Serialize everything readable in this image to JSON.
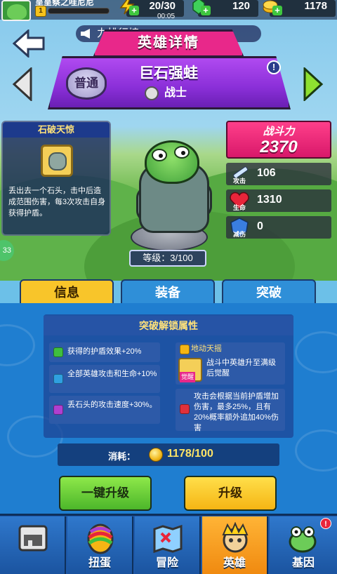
{
  "player": {
    "name": "呈呈察之哇尼尼",
    "level": "1"
  },
  "resources": {
    "energy": {
      "value": "20/30",
      "timer": "00:05"
    },
    "gems": {
      "value": "120"
    },
    "gold": {
      "value": "1178"
    }
  },
  "marquee": {
    "text": "力排行榜"
  },
  "header": {
    "title": "英雄详情",
    "rarity": "普通",
    "hero_name": "巨石强蛙",
    "hero_class": "战士",
    "info": "!"
  },
  "skill": {
    "name": "石破天惊",
    "description": "丢出去一个石头，击中后造成范围伤害，每3次攻击自身获得护盾。"
  },
  "hero": {
    "level_label": "等级：3/100"
  },
  "stats": {
    "power_label": "战斗力",
    "power_value": "2370",
    "attack": {
      "label": "攻击",
      "value": "106"
    },
    "hp": {
      "label": "生命",
      "value": "1310"
    },
    "reduction": {
      "label": "减伤",
      "value": "0"
    }
  },
  "side": {
    "value": "33"
  },
  "tabs": [
    {
      "label": "信息",
      "active": true
    },
    {
      "label": "装备",
      "active": false
    },
    {
      "label": "突破",
      "active": false
    }
  ],
  "breakthrough": {
    "title": "突破解锁属性",
    "attrs_left": [
      {
        "text": "获得的护盾效果+20%",
        "lock_color": "#3fbf3f"
      },
      {
        "text": "全部英雄攻击和生命+10%",
        "lock_color": "#2fa0e0"
      },
      {
        "text": "丢石头的攻击速度+30%。",
        "lock_color": "#b03fd0"
      }
    ],
    "awaken": {
      "title": "地动天摇",
      "text": "战斗中英雄升至满级后觉醒",
      "tag": "觉醒",
      "lock_color": "#f5b514"
    },
    "attr_right": {
      "text": "攻击会根据当前护盾增加伤害，最多25%，且有20%概率额外追加40%伤害",
      "lock_color": "#e0303a"
    }
  },
  "cost": {
    "label": "消耗：",
    "value": "1178/100"
  },
  "buttons": {
    "one_click": "一键升级",
    "upgrade": "升级"
  },
  "bottom_nav": [
    {
      "label": "",
      "selected": false
    },
    {
      "label": "扭蛋",
      "selected": false
    },
    {
      "label": "冒险",
      "selected": false
    },
    {
      "label": "英雄",
      "selected": true
    },
    {
      "label": "基因",
      "selected": false,
      "badge": "!"
    }
  ],
  "colors": {
    "accent": "#e8288a",
    "hero_plate": "#8a2fd8",
    "tab_active": "#f8c52a",
    "content_bg": "#1f7ed0"
  }
}
